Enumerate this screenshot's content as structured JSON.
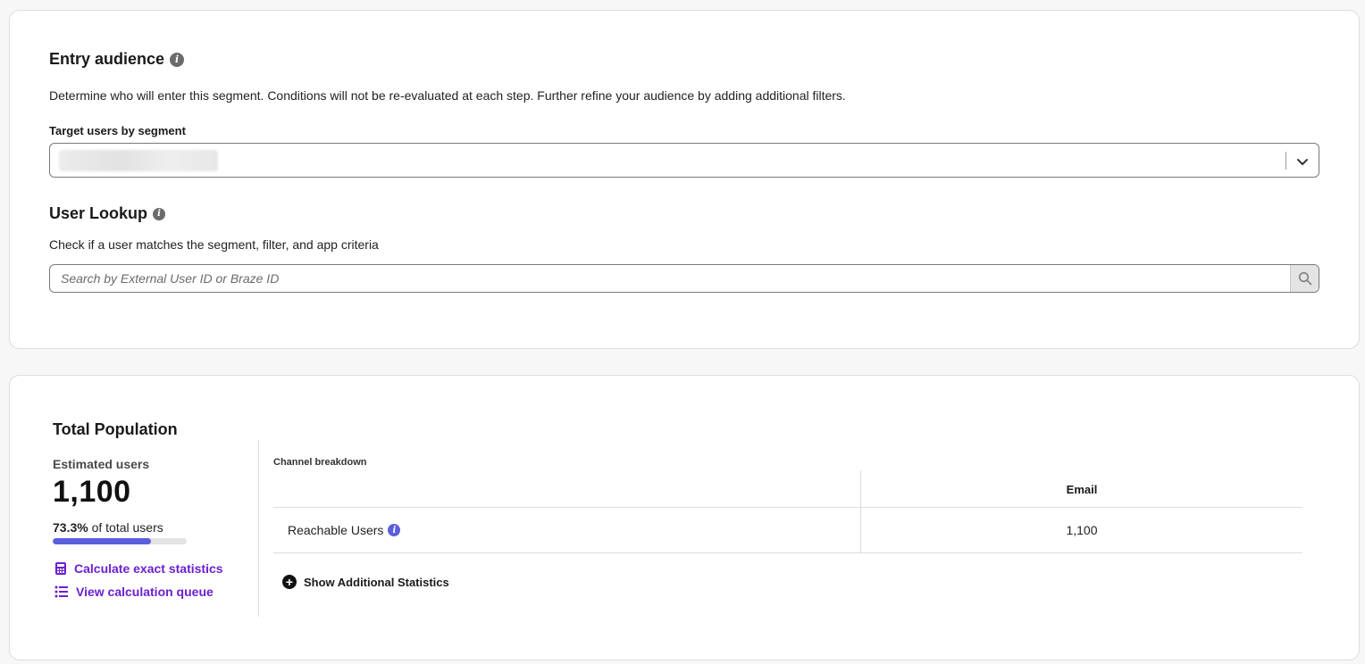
{
  "entry_audience": {
    "title": "Entry audience",
    "description": "Determine who will enter this segment. Conditions will not be re-evaluated at each step. Further refine your audience by adding additional filters.",
    "target_label": "Target users by segment"
  },
  "user_lookup": {
    "title": "User Lookup",
    "description": "Check if a user matches the segment, filter, and app criteria",
    "search_placeholder": "Search by External User ID or Braze ID"
  },
  "population": {
    "title": "Total Population",
    "estimated_label": "Estimated users",
    "estimated_value": "1,100",
    "percent_text": "73.3%",
    "percent_suffix": "of total users",
    "percent_fill": 0.733,
    "calc_link": "Calculate exact statistics",
    "queue_link": "View calculation queue"
  },
  "channel_breakdown": {
    "title": "Channel breakdown",
    "columns": [
      "",
      "Email"
    ],
    "rows": [
      {
        "label": "Reachable Users",
        "email": "1,100"
      }
    ],
    "show_more": "Show Additional Statistics"
  },
  "colors": {
    "accent": "#5b5fde",
    "link": "#6a1fd0",
    "border": "#dedede"
  },
  "icons": {
    "info": "info-icon",
    "chevron": "chevron-down-icon",
    "search": "search-icon",
    "calculator": "calculator-icon",
    "list": "list-icon",
    "plus": "plus-circle-icon"
  }
}
